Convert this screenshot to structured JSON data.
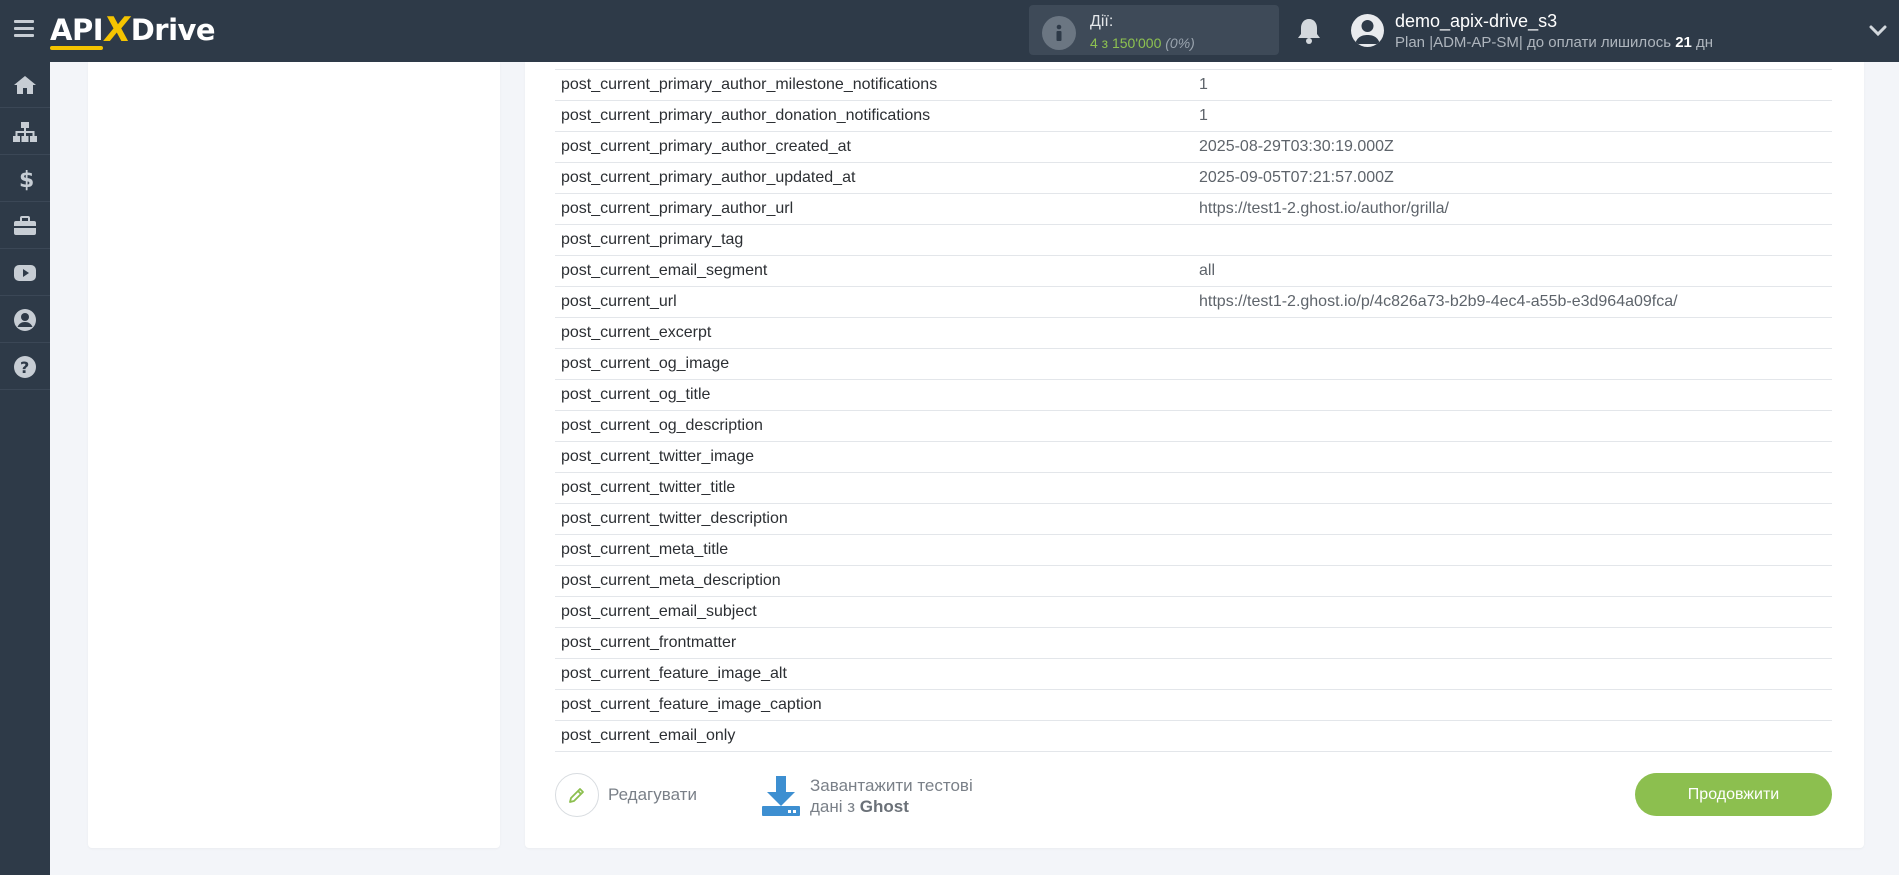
{
  "header": {
    "brand": {
      "api": "API",
      "x": "X",
      "drive": "Drive"
    },
    "actions": {
      "label": "Дії:",
      "used": "4 з 150'000",
      "percent": "(0%)"
    },
    "user": {
      "name": "demo_apix-drive_s3",
      "plan_prefix": "Plan |ADM-AP-SM| до оплати лишилось ",
      "days": "21",
      "days_suffix": " дн"
    }
  },
  "sidebar": {
    "items": [
      {
        "icon": "home-icon"
      },
      {
        "icon": "sitemap-icon"
      },
      {
        "icon": "dollar-icon"
      },
      {
        "icon": "briefcase-icon"
      },
      {
        "icon": "youtube-icon"
      },
      {
        "icon": "user-circle-icon"
      },
      {
        "icon": "question-circle-icon"
      }
    ]
  },
  "table": {
    "rows": [
      {
        "key": "post_current_primary_author_milestone_notifications",
        "value": "1"
      },
      {
        "key": "post_current_primary_author_donation_notifications",
        "value": "1"
      },
      {
        "key": "post_current_primary_author_created_at",
        "value": "2025-08-29T03:30:19.000Z"
      },
      {
        "key": "post_current_primary_author_updated_at",
        "value": "2025-09-05T07:21:57.000Z"
      },
      {
        "key": "post_current_primary_author_url",
        "value": "https://test1-2.ghost.io/author/grilla/"
      },
      {
        "key": "post_current_primary_tag",
        "value": ""
      },
      {
        "key": "post_current_email_segment",
        "value": "all"
      },
      {
        "key": "post_current_url",
        "value": "https://test1-2.ghost.io/p/4c826a73-b2b9-4ec4-a55b-e3d964a09fca/"
      },
      {
        "key": "post_current_excerpt",
        "value": ""
      },
      {
        "key": "post_current_og_image",
        "value": ""
      },
      {
        "key": "post_current_og_title",
        "value": ""
      },
      {
        "key": "post_current_og_description",
        "value": ""
      },
      {
        "key": "post_current_twitter_image",
        "value": ""
      },
      {
        "key": "post_current_twitter_title",
        "value": ""
      },
      {
        "key": "post_current_twitter_description",
        "value": ""
      },
      {
        "key": "post_current_meta_title",
        "value": ""
      },
      {
        "key": "post_current_meta_description",
        "value": ""
      },
      {
        "key": "post_current_email_subject",
        "value": ""
      },
      {
        "key": "post_current_frontmatter",
        "value": ""
      },
      {
        "key": "post_current_feature_image_alt",
        "value": ""
      },
      {
        "key": "post_current_feature_image_caption",
        "value": ""
      },
      {
        "key": "post_current_email_only",
        "value": ""
      }
    ]
  },
  "footer": {
    "edit_label": "Редагувати",
    "download_line1": "Завантажити тестові",
    "download_line2_prefix": "дані з ",
    "download_source": "Ghost",
    "continue_label": "Продовжити"
  },
  "colors": {
    "topbar": "#2e3a48",
    "accent_green": "#8cbf4f",
    "logo_yellow": "#f5c400",
    "download_blue": "#3d8fd1"
  }
}
